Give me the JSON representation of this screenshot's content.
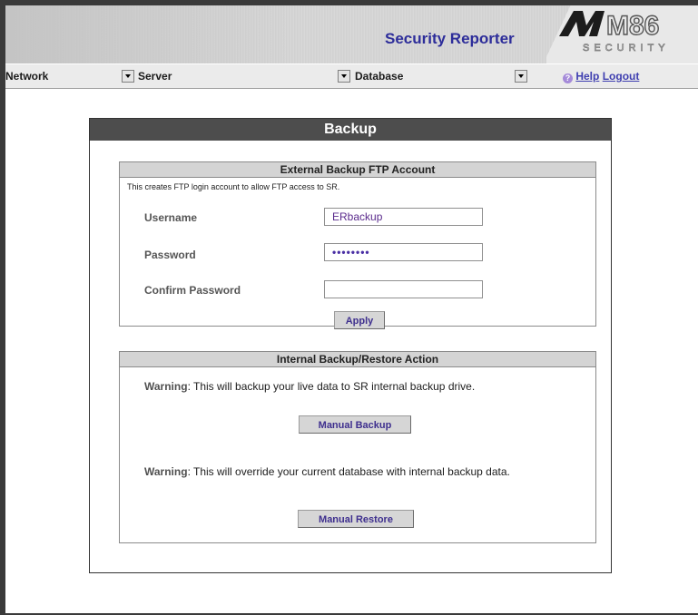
{
  "header": {
    "app_title": "Security Reporter",
    "logo_text": "M86",
    "logo_subtext": "SECURITY"
  },
  "nav": {
    "items": [
      {
        "label": "Network"
      },
      {
        "label": "Server"
      },
      {
        "label": "Database"
      }
    ],
    "help_label": "Help",
    "logout_label": "Logout"
  },
  "panel": {
    "title": "Backup",
    "ftp_section": {
      "heading": "External Backup FTP Account",
      "note": "This creates FTP login account to allow FTP access to SR.",
      "username_label": "Username",
      "username_value": "ERbackup",
      "password_label": "Password",
      "password_value": "••••••••",
      "confirm_label": "Confirm Password",
      "confirm_value": "",
      "apply_label": "Apply"
    },
    "internal_section": {
      "heading": "Internal Backup/Restore Action",
      "warning_prefix": "Warning",
      "backup_warning": ": This will backup your live data to SR internal backup drive.",
      "backup_button": "Manual Backup",
      "restore_warning": ": This will override your current database with internal backup data.",
      "restore_button": "Manual Restore"
    }
  },
  "colors": {
    "title_blue": "#2d2d9a",
    "panel_header": "#4d4d4d",
    "link": "#3f3fb0"
  }
}
